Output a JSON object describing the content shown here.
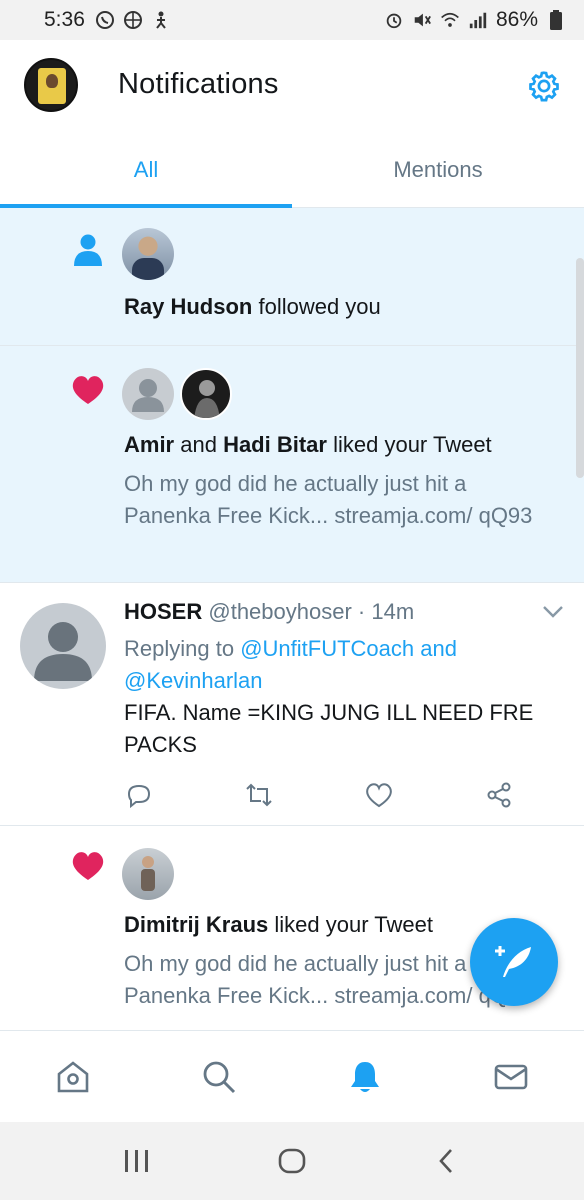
{
  "status_bar": {
    "time": "5:36",
    "battery": "86%",
    "left_icons": [
      "whatsapp-icon",
      "basketball-icon",
      "figure-icon"
    ],
    "right_icons": [
      "alarm-icon",
      "mute-icon",
      "wifi-icon",
      "signal-icon",
      "battery-icon"
    ]
  },
  "header": {
    "title": "Notifications"
  },
  "tabs": [
    {
      "label": "All",
      "active": true
    },
    {
      "label": "Mentions",
      "active": false
    }
  ],
  "notifications": {
    "follow": {
      "name": "Ray Hudson",
      "action": " followed you",
      "icon": "person-icon"
    },
    "like1": {
      "name1": "Amir",
      "joiner": " and ",
      "name2": "Hadi Bitar",
      "action": " liked your Tweet",
      "tweet": "Oh my god did he actually just hit a Panenka Free Kick... streamja.com/ qQ93",
      "icon": "heart-icon"
    },
    "reply": {
      "name": "HOSER",
      "handle": "@theboyhoser",
      "separator": " · ",
      "time": "14m",
      "replying_prefix": "Replying to ",
      "mention1": "@UnfitFUTCoach",
      "and_text": " and",
      "mention2": "@Kevinharlan",
      "body": "FIFA. Name =KING JUNG ILL NEED FRE PACKS"
    },
    "like2": {
      "name": "Dimitrij Kraus",
      "action": " liked your Tweet",
      "tweet": "Oh my god did he actually just hit a Panenka Free Kick... streamja.com/ qQ93",
      "icon": "heart-icon"
    }
  },
  "colors": {
    "accent": "#1da1f2",
    "heart": "#e0245e",
    "unread_bg": "#e8f5fd",
    "muted": "#657786"
  }
}
